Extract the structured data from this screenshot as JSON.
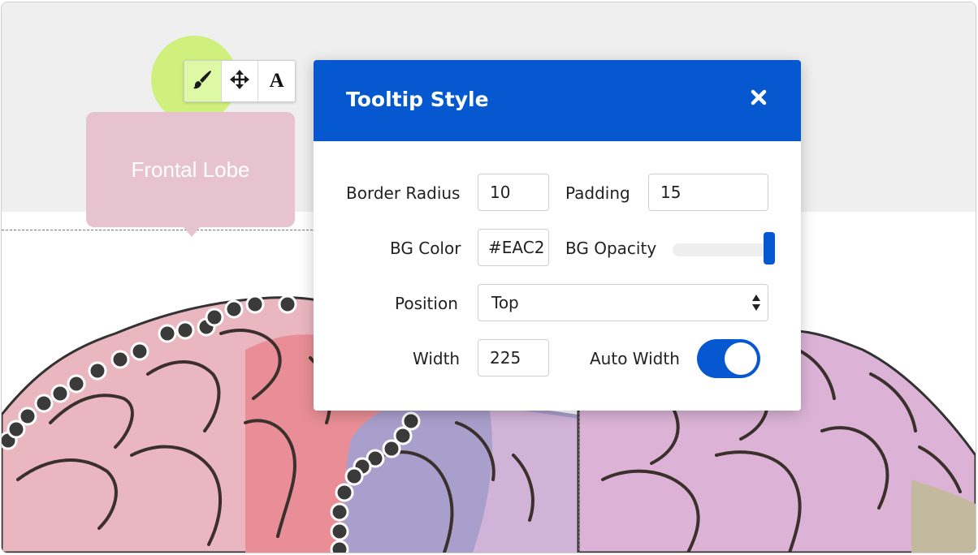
{
  "toolbar": {
    "style_icon": "paintbrush-icon",
    "move_icon": "move-arrows-icon",
    "text_label": "A"
  },
  "tooltip_preview": {
    "text": "Frontal Lobe",
    "bg_color": "#e7c3cf"
  },
  "dialog": {
    "title": "Tooltip Style",
    "close_icon": "close-icon",
    "header_color": "#0558d0",
    "border_radius": {
      "label": "Border Radius",
      "value": "10"
    },
    "padding": {
      "label": "Padding",
      "value": "15"
    },
    "bg_color": {
      "label": "BG Color",
      "value": "#EAC2"
    },
    "bg_opacity": {
      "label": "BG Opacity",
      "level": 1.0
    },
    "position": {
      "label": "Position",
      "selected": "Top"
    },
    "width": {
      "label": "Width",
      "value": "225"
    },
    "auto_width": {
      "label": "Auto Width",
      "on": true
    }
  }
}
